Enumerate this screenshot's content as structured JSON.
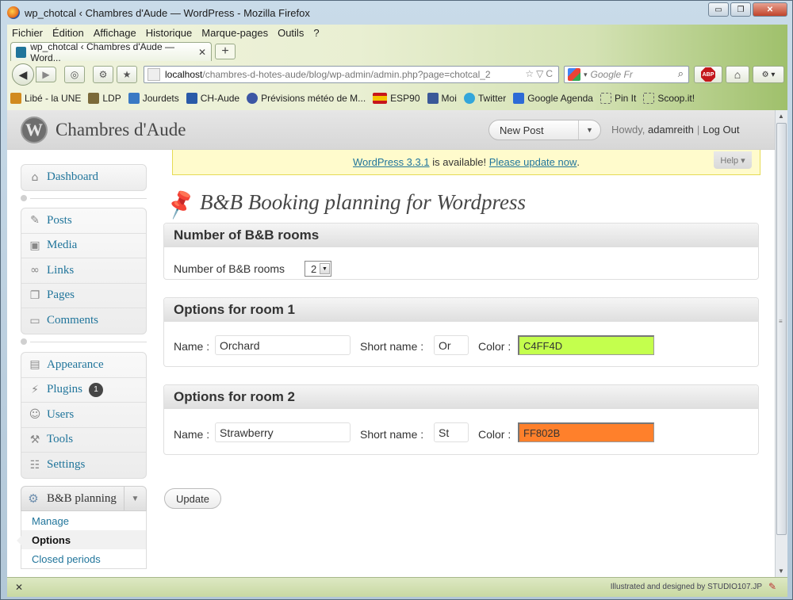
{
  "window": {
    "title": "wp_chotcal ‹ Chambres d'Aude — WordPress - Mozilla Firefox",
    "controls": {
      "minimize": "▭",
      "maximize": "❐",
      "close": "✕"
    }
  },
  "menubar": [
    "Fichier",
    "Édition",
    "Affichage",
    "Historique",
    "Marque-pages",
    "Outils",
    "?"
  ],
  "tab": {
    "label": "wp_chotcal ‹ Chambres d'Aude — Word...",
    "close": "✕",
    "new_tab": "+"
  },
  "navbar": {
    "url_host": "localhost",
    "url_path": "/chambres-d-hotes-aude/blog/wp-admin/admin.php?page=chotcal_2",
    "url_tools": "☆▽C",
    "search_placeholder": "Google Fr",
    "abp_label": "ABP"
  },
  "bookmarks": [
    {
      "label": "Libé - la UNE",
      "color": "#d18a1f"
    },
    {
      "label": "LDP",
      "color": "#7b6a3a"
    },
    {
      "label": "Jourdets",
      "color": "#3a79c4"
    },
    {
      "label": "CH-Aude",
      "color": "#2a5aa8"
    },
    {
      "label": "Prévisions météo de M...",
      "color": "#3c56a4"
    },
    {
      "label": "ESP90",
      "color": "#c7161b"
    },
    {
      "label": "Moi",
      "color": "#3b5998"
    },
    {
      "label": "Twitter",
      "color": "#33a6da"
    },
    {
      "label": "Google Agenda",
      "color": "#2d6bd6"
    },
    {
      "label": "Pin It",
      "color": "#ffffff"
    },
    {
      "label": "Scoop.it!",
      "color": "#ffffff"
    }
  ],
  "wp": {
    "site_title": "Chambres d'Aude",
    "logo_letter": "W",
    "new_post": "New Post",
    "howdy": "Howdy,",
    "username": "adamreith",
    "separator": "|",
    "logout": "Log Out",
    "update_nag": {
      "version_link": "WordPress 3.3.1",
      "middle": " is available! ",
      "update_link": "Please update now",
      "end": "."
    },
    "help": "Help ▾",
    "page_title": "B&B Booking planning for Wordpress"
  },
  "sidebar": {
    "dashboard": "Dashboard",
    "group1": [
      {
        "label": "Posts",
        "icon": "pin-icon"
      },
      {
        "label": "Media",
        "icon": "media-icon"
      },
      {
        "label": "Links",
        "icon": "links-icon"
      },
      {
        "label": "Pages",
        "icon": "pages-icon"
      },
      {
        "label": "Comments",
        "icon": "comments-icon"
      }
    ],
    "group2": [
      {
        "label": "Appearance",
        "icon": "appearance-icon"
      },
      {
        "label": "Plugins",
        "icon": "plugins-icon",
        "badge": "1"
      },
      {
        "label": "Users",
        "icon": "users-icon"
      },
      {
        "label": "Tools",
        "icon": "tools-icon"
      },
      {
        "label": "Settings",
        "icon": "settings-icon"
      }
    ],
    "bb_planning": "B&B planning",
    "submenu": [
      "Manage",
      "Options",
      "Closed periods"
    ],
    "submenu_current": "Options"
  },
  "rooms_box": {
    "title": "Number of B&B rooms",
    "label": "Number of B&B rooms",
    "value": "2"
  },
  "room1": {
    "title": "Options for room 1",
    "name_label": "Name :",
    "name": "Orchard",
    "short_label": "Short name :",
    "short": "Or",
    "color_label": "Color :",
    "color": "C4FF4D",
    "color_hex": "#C4FF4D"
  },
  "room2": {
    "title": "Options for room 2",
    "name_label": "Name :",
    "name": "Strawberry",
    "short_label": "Short name :",
    "short": "St",
    "color_label": "Color :",
    "color": "FF802B",
    "color_hex": "#FF802B"
  },
  "update_button": "Update",
  "statusbar": {
    "close": "✕",
    "credit": "Illustrated and designed by STUDIO107.JP"
  }
}
